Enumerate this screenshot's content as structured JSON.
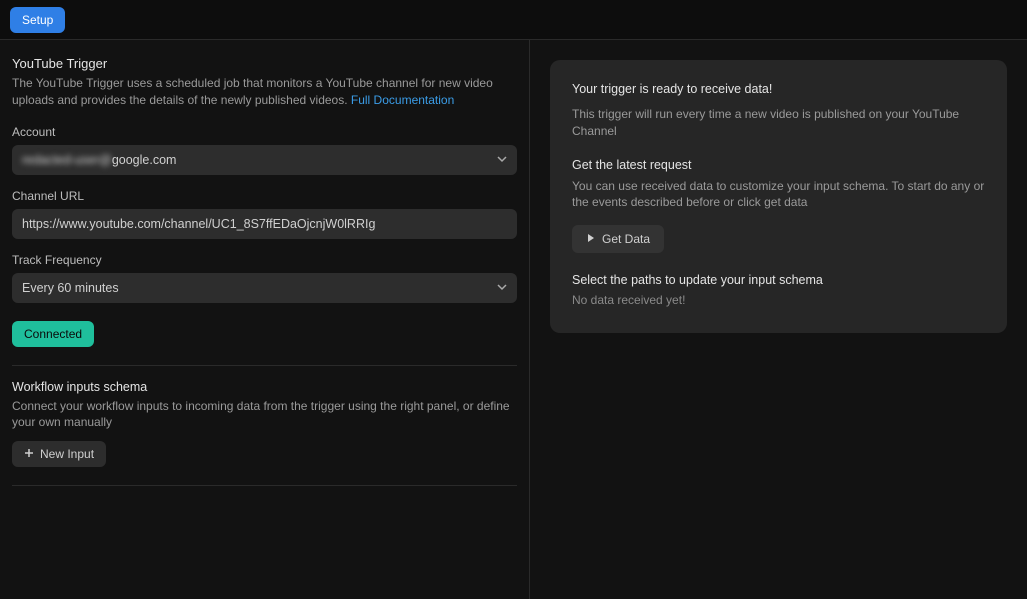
{
  "topbar": {
    "setup_label": "Setup"
  },
  "trigger": {
    "title": "YouTube Trigger",
    "description_prefix": "The YouTube Trigger uses a scheduled job that monitors a YouTube channel for new video uploads and provides the details of the newly published videos. ",
    "doc_link_label": "Full Documentation"
  },
  "fields": {
    "account_label": "Account",
    "account_value_hidden": "redacted-user@",
    "account_value_visible": "google.com",
    "channel_url_label": "Channel URL",
    "channel_url_value": "https://www.youtube.com/channel/UC1_8S7ffEDaOjcnjW0lRRIg",
    "track_freq_label": "Track Frequency",
    "track_freq_value": "Every 60 minutes"
  },
  "status": {
    "connected_label": "Connected"
  },
  "workflow_inputs": {
    "title": "Workflow inputs schema",
    "description": "Connect your workflow inputs to incoming data from the trigger using the right panel, or define your own manually",
    "new_input_label": "New Input"
  },
  "right": {
    "ready_heading": "Your trigger is ready to receive data!",
    "ready_text": "This trigger will run every time a new video is published on your YouTube Channel",
    "latest_heading": "Get the latest request",
    "latest_text": "You can use received data to customize your input schema. To start do any or the events described before or click get data",
    "get_data_label": "Get Data",
    "schema_heading": "Select the paths to update your input schema",
    "no_data_label": "No data received yet!"
  }
}
